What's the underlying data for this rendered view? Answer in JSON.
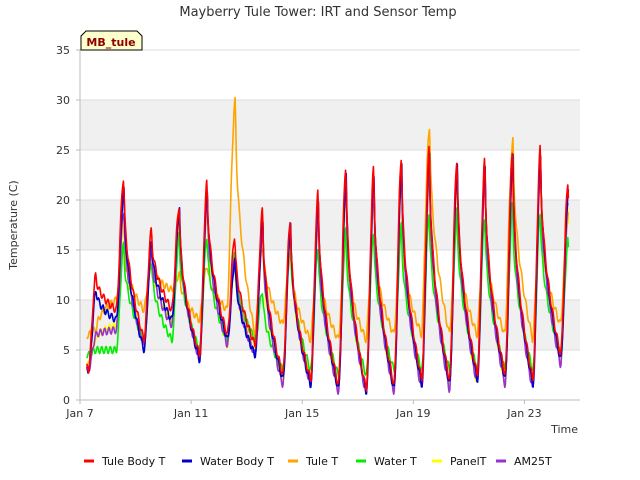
{
  "chart_data": {
    "type": "line",
    "title": "Mayberry Tule Tower: IRT and Sensor Temp",
    "xlabel": "Time",
    "ylabel": "Temperature (C)",
    "badge": "MB_tule",
    "ylim": [
      0,
      35
    ],
    "yticks": [
      0,
      5,
      10,
      15,
      20,
      25,
      30,
      35
    ],
    "xlim": [
      "2024-01-07",
      "2024-01-25"
    ],
    "xtick_labels": [
      "Jan 7",
      "Jan 11",
      "Jan 15",
      "Jan 19",
      "Jan 23"
    ],
    "grid": "horizontal bands",
    "legend_position": "bottom",
    "colors": {
      "band": "#f0f0f0",
      "grid": "#dddddd",
      "axis": "#bbbbbb",
      "badge_fill": "#ffffcc"
    },
    "series": [
      {
        "name": "Tule Body T",
        "color": "#ff0000"
      },
      {
        "name": "Water Body T",
        "color": "#0000cc"
      },
      {
        "name": "Tule T",
        "color": "#ffa500"
      },
      {
        "name": "Water T",
        "color": "#00ee00"
      },
      {
        "name": "PanelT",
        "color": "#ffff00"
      },
      {
        "name": "AM25T",
        "color": "#9933cc"
      }
    ],
    "daily": {
      "days": [
        "2024-01-07",
        "2024-01-08",
        "2024-01-09",
        "2024-01-10",
        "2024-01-11",
        "2024-01-12",
        "2024-01-13",
        "2024-01-14",
        "2024-01-15",
        "2024-01-16",
        "2024-01-17",
        "2024-01-18",
        "2024-01-19",
        "2024-01-20",
        "2024-01-21",
        "2024-01-22",
        "2024-01-23",
        "2024-01-24"
      ],
      "tule_body_max": [
        12.5,
        22.3,
        17.0,
        19.5,
        21.8,
        16.5,
        19.0,
        18.2,
        20.8,
        23.5,
        23.2,
        24.5,
        25.2,
        24.2,
        24.0,
        25.2,
        25.3,
        22.0
      ],
      "tule_body_min": [
        3.0,
        9.0,
        6.0,
        9.0,
        4.5,
        6.5,
        5.5,
        2.5,
        2.0,
        1.5,
        1.0,
        1.5,
        2.0,
        2.0,
        2.5,
        2.5,
        2.0,
        4.5
      ],
      "water_body_max": [
        11.0,
        21.0,
        16.0,
        19.0,
        21.0,
        14.0,
        18.0,
        17.5,
        20.0,
        22.5,
        22.5,
        23.5,
        24.8,
        23.5,
        23.5,
        24.5,
        24.5,
        21.0
      ],
      "water_body_min": [
        3.0,
        8.0,
        5.0,
        8.0,
        4.0,
        6.0,
        4.5,
        2.0,
        1.5,
        1.0,
        0.8,
        1.0,
        1.5,
        1.5,
        2.0,
        2.0,
        1.5,
        4.0
      ],
      "tule_max": [
        7.0,
        15.5,
        13.5,
        12.5,
        13.5,
        30.0,
        15.5,
        14.5,
        15.0,
        16.0,
        17.0,
        17.5,
        27.5,
        18.0,
        18.0,
        26.0,
        19.0,
        18.5
      ],
      "tule_min": [
        6.5,
        10.0,
        9.0,
        11.0,
        8.0,
        9.0,
        6.5,
        7.5,
        6.0,
        6.0,
        6.0,
        6.5,
        6.5,
        6.5,
        6.5,
        6.5,
        6.0,
        7.5
      ],
      "water_max": [
        5.0,
        15.5,
        14.0,
        16.5,
        16.5,
        14.5,
        11.0,
        16.5,
        15.5,
        17.0,
        17.0,
        17.5,
        19.0,
        19.0,
        18.5,
        19.5,
        19.0,
        16.0
      ],
      "water_min": [
        4.5,
        5.0,
        6.0,
        6.0,
        5.0,
        6.0,
        6.0,
        3.0,
        3.0,
        2.5,
        2.5,
        3.0,
        3.0,
        3.0,
        3.0,
        3.0,
        3.0,
        4.5
      ],
      "panel_max": [
        6.0,
        18.0,
        14.5,
        18.0,
        19.5,
        14.0,
        16.0,
        16.5,
        18.0,
        20.5,
        20.5,
        22.0,
        23.0,
        22.5,
        22.5,
        23.0,
        23.0,
        19.0
      ],
      "panel_min": [
        3.5,
        7.5,
        6.0,
        8.0,
        4.5,
        5.5,
        5.0,
        2.0,
        2.0,
        1.0,
        0.8,
        1.0,
        1.5,
        1.5,
        1.5,
        1.5,
        1.5,
        4.0
      ],
      "am25t_max": [
        6.5,
        19.0,
        15.0,
        19.0,
        20.0,
        14.5,
        17.0,
        17.5,
        18.5,
        21.5,
        21.0,
        22.5,
        23.5,
        23.0,
        22.5,
        23.5,
        23.5,
        20.0
      ],
      "am25t_min": [
        3.0,
        7.0,
        5.5,
        7.5,
        4.0,
        5.5,
        4.5,
        1.5,
        1.5,
        0.8,
        0.5,
        0.8,
        1.0,
        1.0,
        1.5,
        1.5,
        1.0,
        3.5
      ]
    }
  }
}
